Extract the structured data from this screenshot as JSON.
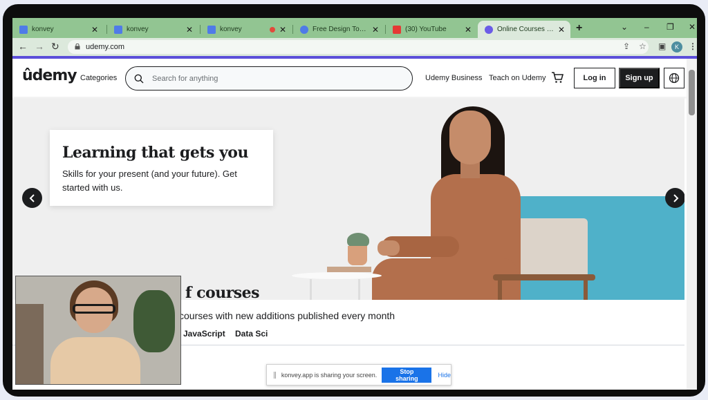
{
  "browser": {
    "tabs": [
      {
        "title": "konvey",
        "favicon_color": "#4f7be8",
        "active": false
      },
      {
        "title": "konvey",
        "favicon_color": "#4f7be8",
        "active": false
      },
      {
        "title": "konvey",
        "favicon_color": "#4f7be8",
        "active": false,
        "recording": true
      },
      {
        "title": "Free Design Tool: Pres",
        "favicon_color": "#4f7be8",
        "active": false
      },
      {
        "title": "(30) YouTube",
        "favicon_color": "#e53935",
        "active": false
      },
      {
        "title": "Online Courses - Learn",
        "favicon_color": "#6b5ce7",
        "active": true
      }
    ],
    "url": "udemy.com",
    "profile_initial": "K"
  },
  "header": {
    "logo": "ûdemy",
    "categories": "Categories",
    "search_placeholder": "Search for anything",
    "business": "Udemy Business",
    "teach": "Teach on Udemy",
    "login": "Log in",
    "signup": "Sign up"
  },
  "hero": {
    "title": "Learning that gets you",
    "subtitle": "Skills for your present (and your future). Get started with us."
  },
  "section": {
    "title": "f courses",
    "subtitle": "courses with new additions published every month",
    "tabs": [
      "JavaScript",
      "Data Sci"
    ]
  },
  "share_bar": {
    "text": "konvey.app is sharing your screen.",
    "stop": "Stop sharing",
    "hide": "Hide"
  },
  "colors": {
    "brand_purple": "#a435f0",
    "accent_line": "#5b4fd9",
    "tabstrip": "#92c592",
    "share_blue": "#1a73e8"
  }
}
